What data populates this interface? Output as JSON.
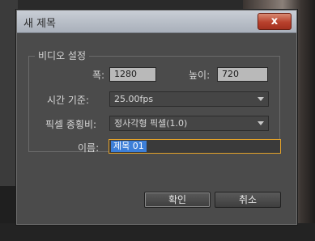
{
  "dialog": {
    "title": "새 제목",
    "close_label": "x",
    "group_label": "비디오 설정",
    "width_label": "폭:",
    "width_value": "1280",
    "height_label": "높이:",
    "height_value": "720",
    "timebase_label": "시간 기준:",
    "timebase_value": "25.00fps",
    "par_label": "픽셀 종횡비:",
    "par_value": "정사각형 픽셀(1.0)",
    "name_label": "이름:",
    "name_value": "제목 01",
    "ok_label": "확인",
    "cancel_label": "취소"
  }
}
